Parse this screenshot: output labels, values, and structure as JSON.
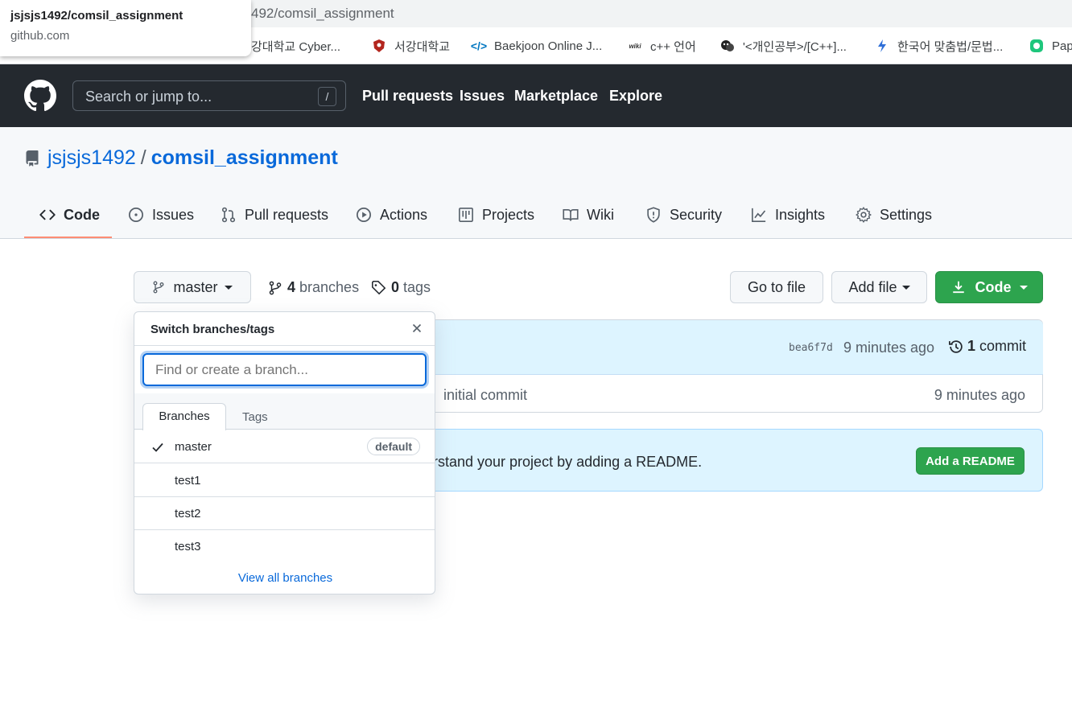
{
  "browser": {
    "url_visible": "492/comsil_assignment",
    "tooltip_title": "jsjsjs1492/comsil_assignment",
    "tooltip_host": "github.com",
    "bookmarks": [
      {
        "label": "강대학교 Cyber...",
        "icon": "globe-icon"
      },
      {
        "label": "서강대학교",
        "icon": "shield-icon",
        "color": "#b3261e"
      },
      {
        "label": "Baekjoon Online J...",
        "icon": "code-icon",
        "color": "#0076c0"
      },
      {
        "label": "c++ 언어",
        "icon": "wiki-icon"
      },
      {
        "label": "'<개인공부>/[C++]...",
        "icon": "mask-icon"
      },
      {
        "label": "한국어 맞춤법/문법...",
        "icon": "lightning-icon",
        "color": "#2f6fd8"
      },
      {
        "label": "Pap",
        "icon": "papago-icon",
        "color": "#1ec67c"
      }
    ]
  },
  "header": {
    "search_placeholder": "Search or jump to...",
    "search_shortcut": "/",
    "nav": [
      "Pull requests",
      "Issues",
      "Marketplace",
      "Explore"
    ]
  },
  "repo": {
    "owner": "jsjsjs1492",
    "separator": "/",
    "name": "comsil_assignment",
    "tabs": [
      {
        "label": "Code",
        "icon": "code-icon",
        "active": true
      },
      {
        "label": "Issues",
        "icon": "issue-icon"
      },
      {
        "label": "Pull requests",
        "icon": "pull-request-icon"
      },
      {
        "label": "Actions",
        "icon": "play-icon"
      },
      {
        "label": "Projects",
        "icon": "project-icon"
      },
      {
        "label": "Wiki",
        "icon": "book-icon"
      },
      {
        "label": "Security",
        "icon": "shield-icon"
      },
      {
        "label": "Insights",
        "icon": "graph-icon"
      },
      {
        "label": "Settings",
        "icon": "gear-icon"
      }
    ]
  },
  "toolbar": {
    "branch_button": "master",
    "branches_count": "4",
    "branches_label": "branches",
    "tags_count": "0",
    "tags_label": "tags",
    "go_to_file": "Go to file",
    "add_file": "Add file",
    "code": "Code"
  },
  "commit": {
    "sha": "bea6f7d",
    "time": "9 minutes ago",
    "count": "1",
    "count_label": "commit",
    "row_message": "initial commit",
    "row_time": "9 minutes ago"
  },
  "readme": {
    "text": "rstand your project by adding a README.",
    "button": "Add a README"
  },
  "dropdown": {
    "title": "Switch branches/tags",
    "input_placeholder": "Find or create a branch...",
    "tab_branches": "Branches",
    "tab_tags": "Tags",
    "branches": [
      {
        "name": "master",
        "selected": true,
        "badge": "default"
      },
      {
        "name": "test1"
      },
      {
        "name": "test2"
      },
      {
        "name": "test3"
      }
    ],
    "view_all": "View all branches"
  }
}
